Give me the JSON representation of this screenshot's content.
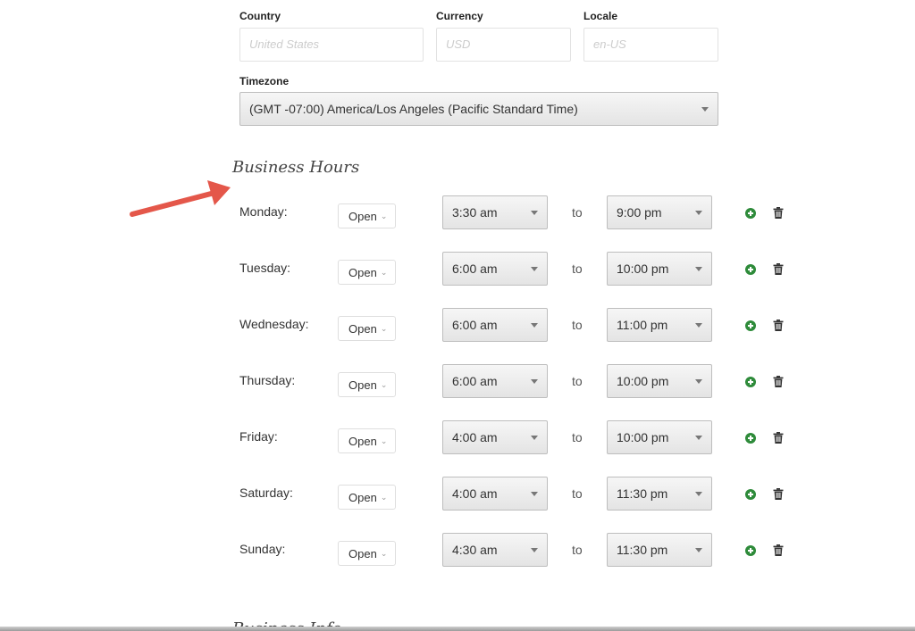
{
  "settings": {
    "country_label": "Country",
    "country_placeholder": "United States",
    "currency_label": "Currency",
    "currency_placeholder": "USD",
    "locale_label": "Locale",
    "locale_placeholder": "en-US",
    "timezone_label": "Timezone",
    "timezone_value": "(GMT -07:00) America/Los Angeles (Pacific Standard Time)"
  },
  "business_hours": {
    "title": "Business Hours",
    "to_label": "to",
    "days": [
      {
        "day": "Monday:",
        "status": "Open",
        "open": "3:30 am",
        "close": "9:00 pm"
      },
      {
        "day": "Tuesday:",
        "status": "Open",
        "open": "6:00 am",
        "close": "10:00 pm"
      },
      {
        "day": "Wednesday:",
        "status": "Open",
        "open": "6:00 am",
        "close": "11:00 pm"
      },
      {
        "day": "Thursday:",
        "status": "Open",
        "open": "6:00 am",
        "close": "10:00 pm"
      },
      {
        "day": "Friday:",
        "status": "Open",
        "open": "4:00 am",
        "close": "10:00 pm"
      },
      {
        "day": "Saturday:",
        "status": "Open",
        "open": "4:00 am",
        "close": "11:30 pm"
      },
      {
        "day": "Sunday:",
        "status": "Open",
        "open": "4:30 am",
        "close": "11:30 pm"
      }
    ]
  },
  "next_section_title": "Business Info",
  "colors": {
    "add_icon": "#2e8b3a",
    "arrow": "#e4574a"
  }
}
